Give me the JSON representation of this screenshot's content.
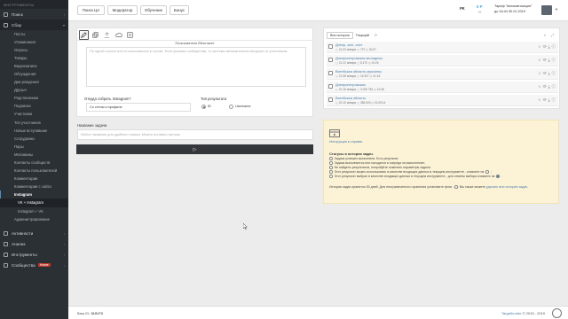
{
  "sidebar": {
    "header": "ИНСТРУМЕНТЫ",
    "top_sections": [
      {
        "label": "Поиск",
        "icon": "search-icon"
      },
      {
        "label": "Сбор",
        "icon": "collect-icon"
      }
    ],
    "items": [
      "Посты",
      "Упоминания",
      "Опросы",
      "Товары",
      "Видеозаписи",
      "Обсуждения",
      "Дни рождения",
      "Друзья",
      "Родственники",
      "Подписки",
      "Участники",
      "Топ участников",
      "Новые вступившие",
      "Сотрудники",
      "Пары",
      "Меломаны",
      "Контакты сообществ",
      "Контакты пользователей",
      "Комментарии",
      "Комментарии с сайта"
    ],
    "instagram": {
      "label": "Instagram",
      "subs": [
        "VK + Instagram",
        "Instagram + VK"
      ]
    },
    "admin": "Администрирование",
    "bottom_sections": [
      {
        "label": "Активности",
        "icon": "activity-icon"
      },
      {
        "label": "Анализ",
        "icon": "analysis-icon"
      },
      {
        "label": "Инструменты",
        "icon": "tools-icon"
      },
      {
        "label": "Сообщества",
        "icon": "groups-icon",
        "badge": "Новое"
      }
    ]
  },
  "topbar": {
    "buttons": [
      "Поиск ЦА",
      "Модератор",
      "Обучение",
      "Бонус"
    ],
    "lang": "РК",
    "balance": "0 Р",
    "balance_sub": "+0",
    "tariff_line1": "Тариф \"Автоматизация\"",
    "tariff_line2": "до 16:44 30.01.2019"
  },
  "task_panel": {
    "vk_label": "Пользователи ВКонтакте",
    "vk_placeholder": "По одной ссылке или id пользователя в строке. Если указаны сообщества, то система автоматически выгрузит их участников.",
    "source_label": "Откуда собрать Instagram?",
    "source_value": "Со стены и профиля",
    "result_label": "Тип результата",
    "result_options": [
      "ID",
      "Username"
    ]
  },
  "task_name": {
    "label": "Название задачи",
    "placeholder": "Любое название для удобного поиска. Можно оставить пустым."
  },
  "history": {
    "tabs": [
      "Вся история",
      "Текущий"
    ],
    "rows": [
      {
        "title": "Днепр, жен, инст",
        "date": "21.03 января",
        "count": "727",
        "time": "00:07"
      },
      {
        "title": "Днепропетровская молодежь",
        "date": "21.22 января",
        "count": "8 470",
        "time": "24:26"
      },
      {
        "title": "Витебская область мужчины",
        "date": "21.08 января",
        "count": "16 307",
        "time": "01:18"
      },
      {
        "title": "Днепропетровская",
        "date": "20.16 января",
        "count": "3 005 782",
        "time": "10:08"
      },
      {
        "title": "Витебская область",
        "date": "20.15 января",
        "count": "385 600",
        "time": "01:09:14"
      }
    ]
  },
  "info": {
    "guide_link": "Инструкция в справке",
    "statuses_title": "Статусы и история задач.",
    "statuses": [
      "Задача успешно выполнена. Есть результат;",
      "Задача выполняется или находится в очереди на выполнение;",
      "Не найдено результатов, попробуйте поменять параметры задачи;",
      "Этот результат можно использовать в качестве входящих данных в текущем инструменте - кликните на",
      "Этот результат выбран в качестве входящих данных в текущем инструменте - для отмены выбора кликните на"
    ],
    "note_part1": "История задач хранится 30 дней. Для неограниченного хранения установите флаг -",
    "note_part2": ". Вы также можете",
    "note_link": "удалить всю историю задач",
    "note_end": "."
  },
  "footer": {
    "id_label": "Ваш ID:",
    "id_value": "319173",
    "brand": "Targethunter",
    "copyright": "© 2015 - 2019"
  }
}
